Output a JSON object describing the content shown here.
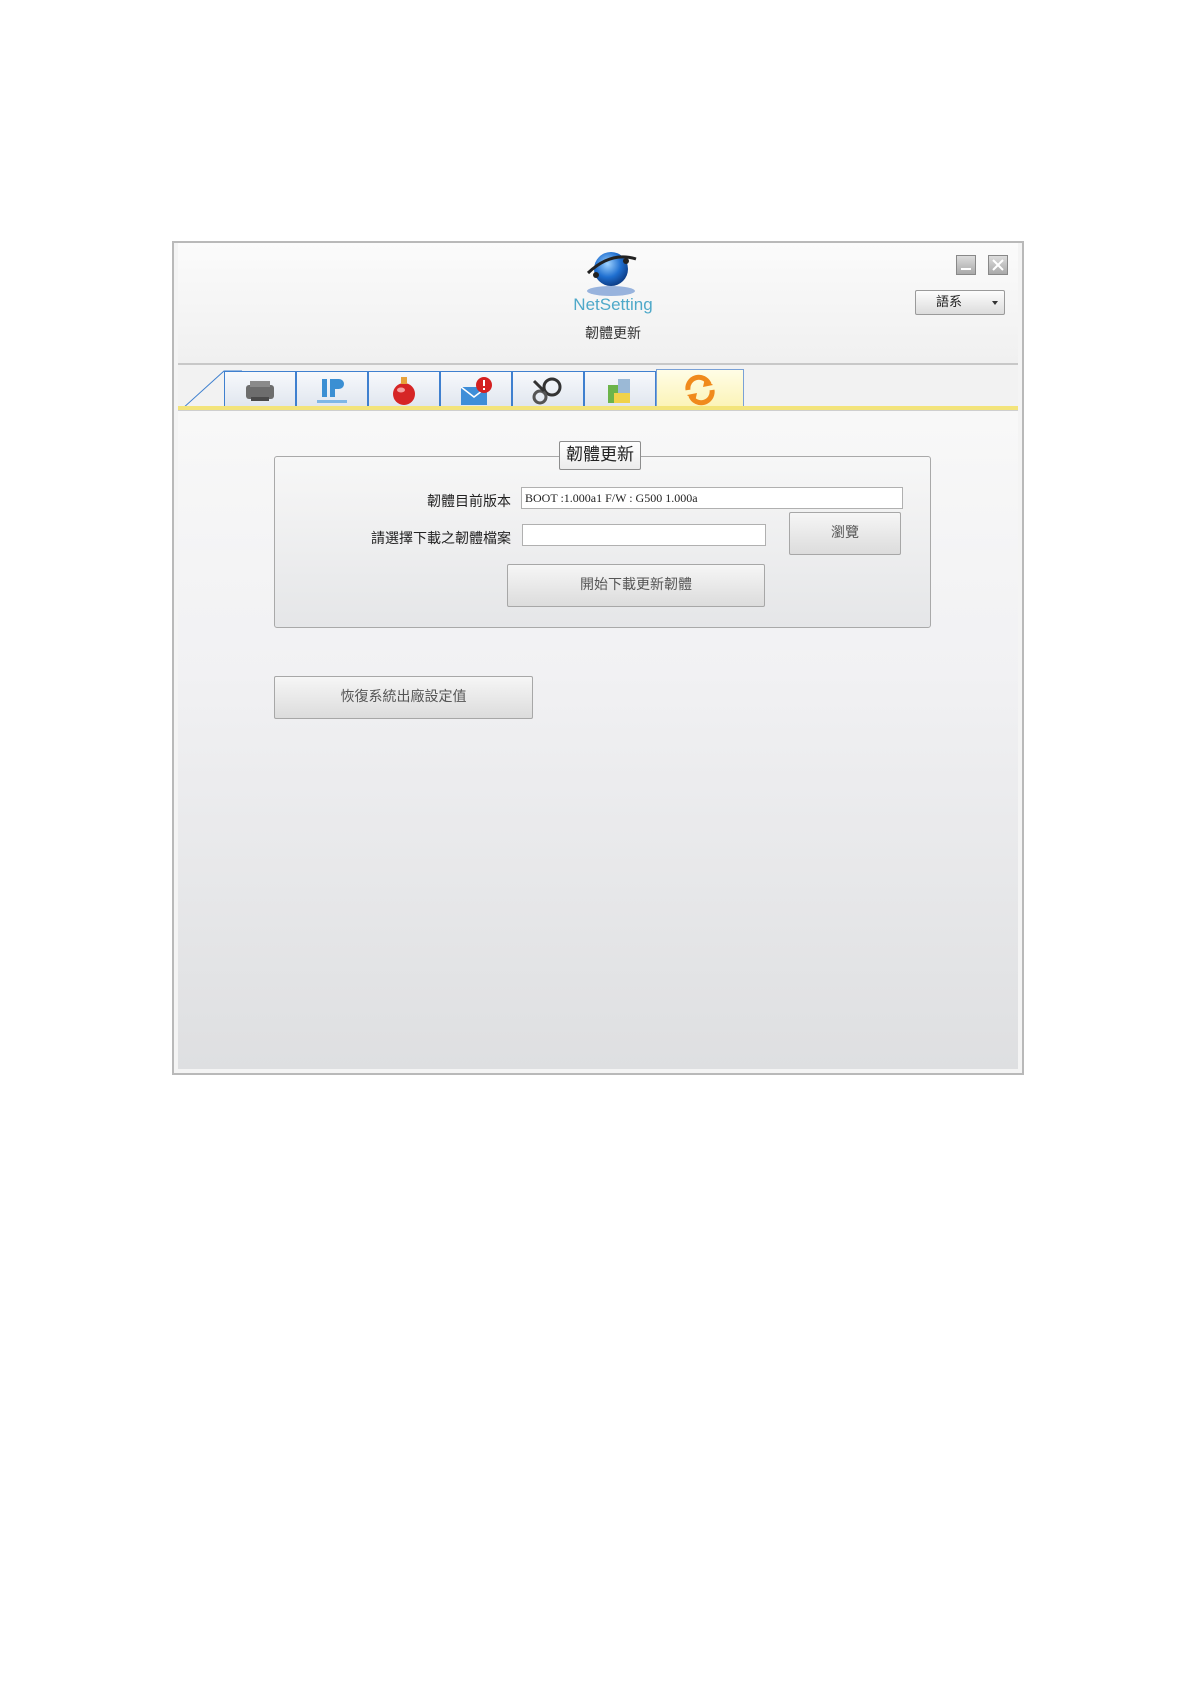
{
  "header": {
    "logo_text": "NetSetting",
    "title": "韌體更新",
    "language_select": "語系"
  },
  "tabs": [
    {
      "name": "printer-tab",
      "icon": "printer-icon",
      "active": false
    },
    {
      "name": "ip-setting-tab",
      "icon": "ip-setting-icon",
      "active": false
    },
    {
      "name": "alert-tab",
      "icon": "bell-icon",
      "active": false
    },
    {
      "name": "email-alert-tab",
      "icon": "mail-alert-icon",
      "active": false
    },
    {
      "name": "tools-tab",
      "icon": "tools-icon",
      "active": false
    },
    {
      "name": "proxy-tab",
      "icon": "proxy-icon",
      "active": false
    },
    {
      "name": "firmware-update-tab",
      "icon": "refresh-icon",
      "active": true
    }
  ],
  "firmware": {
    "group_title": "韌體更新",
    "current_version_label": "韌體目前版本",
    "current_version_value": "BOOT :1.000a1  F/W : G500 1.000a",
    "select_file_label": "請選擇下載之韌體檔案",
    "select_file_value": "",
    "browse_button": "瀏覽",
    "start_update_button": "開始下載更新韌體"
  },
  "factory_reset_button": "恢復系統出廠設定值",
  "colors": {
    "tab_border": "#3f80cf",
    "active_tab": "#fbf3b5",
    "logo_text": "#4fa9c9"
  }
}
